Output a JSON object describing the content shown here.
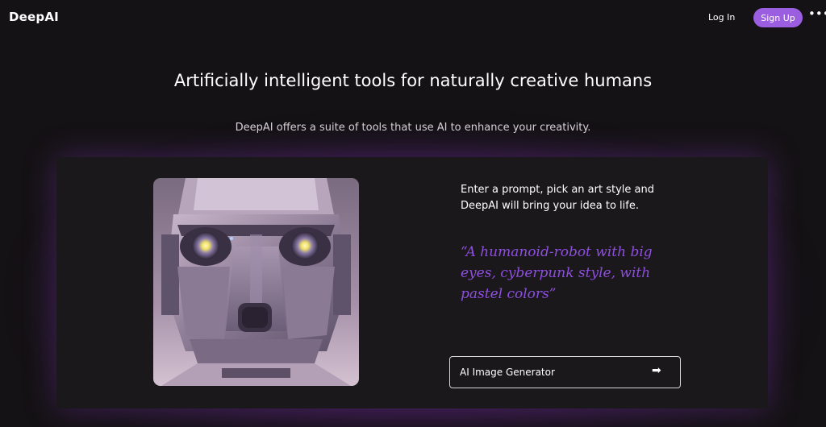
{
  "header": {
    "logo": "DeepAI",
    "login_label": "Log In",
    "signup_label": "Sign Up",
    "more_label": "•••",
    "more_icon": "ellipsis-icon"
  },
  "hero": {
    "headline": "Artificially intelligent tools for naturally creative humans",
    "subline": "DeepAI offers a suite of tools that use AI to enhance your creativity."
  },
  "feature": {
    "description": "Enter a prompt, pick an art style and DeepAI will bring your idea to life.",
    "example_prompt": "“A humanoid-robot with big eyes, cyberpunk style, with pastel colors”",
    "button_label": "AI Image Generator",
    "button_arrow": "➡",
    "image_subject": "robot-illustration"
  },
  "colors": {
    "background": "#141214",
    "card": "#1a181a",
    "accent": "#9b5ee0",
    "quote": "#8e4fe0"
  }
}
